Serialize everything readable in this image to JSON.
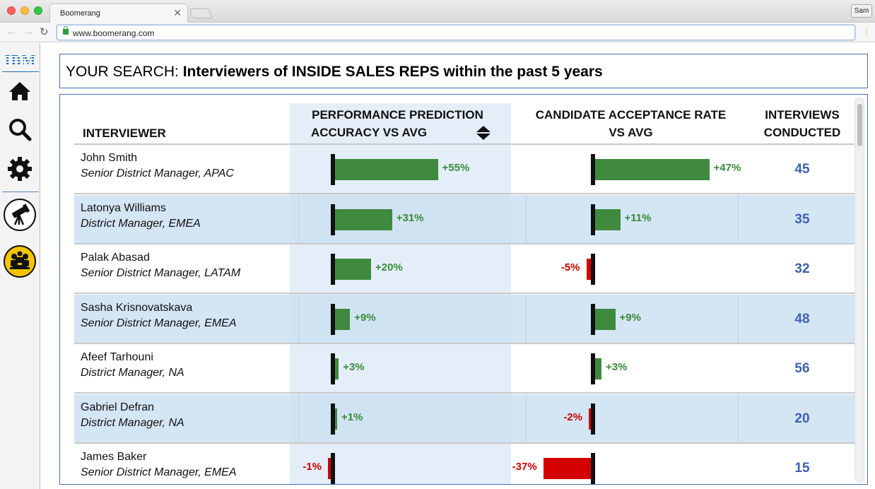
{
  "browser": {
    "tab_title": "Boomerang",
    "tab_close": "✕",
    "profile": "Sam",
    "url": "www.boomerang.com",
    "back": "←",
    "forward": "→",
    "reload": "↻",
    "menu": "⋮"
  },
  "sidebar": {
    "logo": "IBM",
    "items": [
      {
        "icon": "home-icon"
      },
      {
        "icon": "search-icon"
      },
      {
        "icon": "gear-icon"
      },
      {
        "icon": "telescope-icon"
      },
      {
        "icon": "people-icon"
      }
    ]
  },
  "search": {
    "prefix": "YOUR SEARCH: ",
    "query": "Interviewers of INSIDE SALES REPS within the past 5 years"
  },
  "table": {
    "headers": {
      "interviewer": "INTERVIEWER",
      "perf_line1": "PERFORMANCE PREDICTION",
      "perf_line2": "ACCURACY VS AVG",
      "cand_line1": "CANDIDATE ACCEPTANCE RATE",
      "cand_line2": "VS AVG",
      "count_line1": "INTERVIEWS",
      "count_line2": "CONDUCTED"
    },
    "rows": [
      {
        "name": "John Smith",
        "title": "Senior District Manager, APAC",
        "perf": 55,
        "perf_label": "+55%",
        "cand": 47,
        "cand_label": "+47%",
        "count": "45"
      },
      {
        "name": "Latonya Williams",
        "title": "District Manager, EMEA",
        "perf": 31,
        "perf_label": "+31%",
        "cand": 11,
        "cand_label": "+11%",
        "count": "35"
      },
      {
        "name": "Palak Abasad",
        "title": "Senior District Manager, LATAM",
        "perf": 20,
        "perf_label": "+20%",
        "cand": -5,
        "cand_label": "-5%",
        "count": "32"
      },
      {
        "name": "Sasha Krisnovatskava",
        "title": "Senior District Manager, EMEA",
        "perf": 9,
        "perf_label": "+9%",
        "cand": 9,
        "cand_label": "+9%",
        "count": "48"
      },
      {
        "name": "Afeef Tarhouni",
        "title": " District Manager, NA",
        "perf": 3,
        "perf_label": "+3%",
        "cand": 3,
        "cand_label": "+3%",
        "count": "56"
      },
      {
        "name": "Gabriel Defran",
        "title": "District Manager, NA",
        "perf": 1,
        "perf_label": "+1%",
        "cand": -2,
        "cand_label": "-2%",
        "count": "20"
      },
      {
        "name": "James Baker",
        "title": "Senior District Manager, EMEA",
        "perf": -1,
        "perf_label": "-1%",
        "cand": -37,
        "cand_label": "-37%",
        "count": "15"
      }
    ]
  },
  "colors": {
    "positive": "#3f8a3f",
    "negative": "#d40000",
    "count": "#3d62b0",
    "border": "#4a6fb4"
  }
}
